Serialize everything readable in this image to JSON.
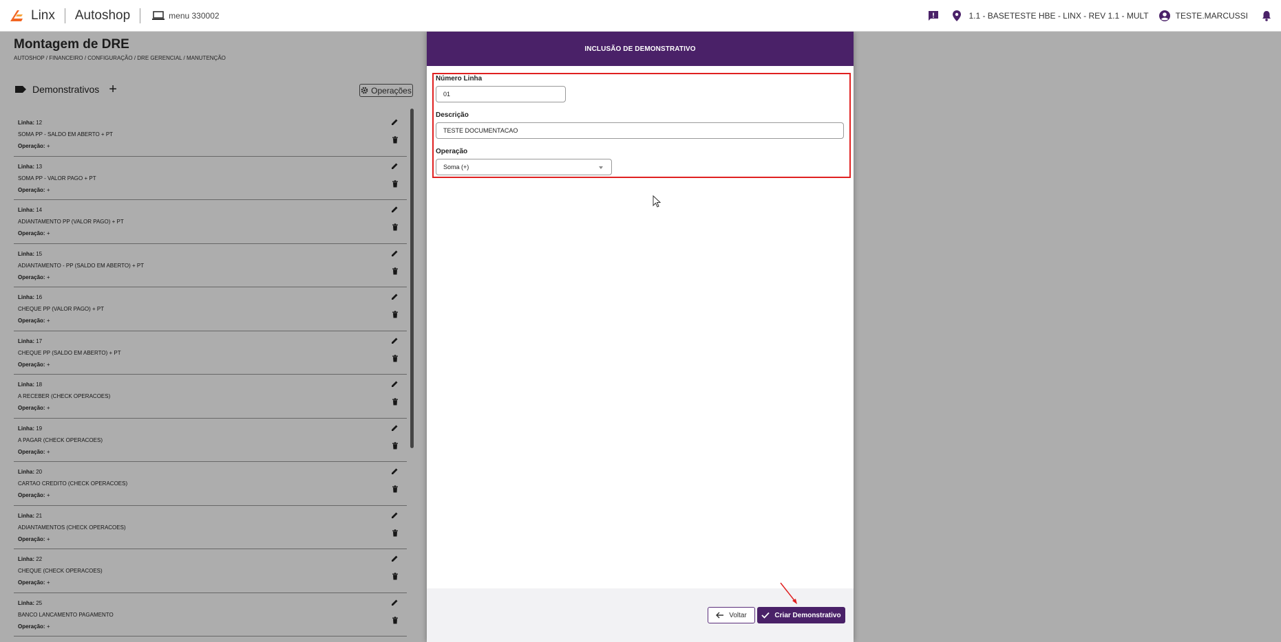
{
  "topbar": {
    "brand": "Linx",
    "app": "Autoshop",
    "menu": "menu 330002",
    "location": "1.1 - BASETESTE HBE - LINX - REV 1.1 - MULT",
    "user": "TESTE.MARCUSSI"
  },
  "page": {
    "title": "Montagem de DRE",
    "breadcrumb": "AUTOSHOP / FINANCEIRO / CONFIGURAÇÃO / DRE GERENCIAL / MANUTENÇÃO",
    "section_label": "Demonstrativos",
    "add_symbol": "+",
    "operations_label": "Operações",
    "line_label": "Linha:",
    "op_label": "Operação:",
    "rows": [
      {
        "linha": "12",
        "desc": "SOMA PP - SALDO EM ABERTO + PT",
        "op": "+"
      },
      {
        "linha": "13",
        "desc": "SOMA PP - VALOR PAGO + PT",
        "op": "+"
      },
      {
        "linha": "14",
        "desc": "ADIANTAMENTO PP (VALOR PAGO) + PT",
        "op": "+"
      },
      {
        "linha": "15",
        "desc": "ADIANTAMENTO - PP (SALDO EM ABERTO) + PT",
        "op": "+"
      },
      {
        "linha": "16",
        "desc": "CHEQUE PP (VALOR PAGO) + PT",
        "op": "+"
      },
      {
        "linha": "17",
        "desc": "CHEQUE PP (SALDO EM ABERTO) + PT",
        "op": "+"
      },
      {
        "linha": "18",
        "desc": "A RECEBER (CHECK OPERACOES)",
        "op": "+"
      },
      {
        "linha": "19",
        "desc": "A PAGAR (CHECK OPERACOES)",
        "op": "+"
      },
      {
        "linha": "20",
        "desc": "CARTAO CREDITO (CHECK OPERACOES)",
        "op": "+"
      },
      {
        "linha": "21",
        "desc": "ADIANTAMENTOS (CHECK OPERACOES)",
        "op": "+"
      },
      {
        "linha": "22",
        "desc": "CHEQUE (CHECK OPERACOES)",
        "op": "+"
      },
      {
        "linha": "25",
        "desc": "BANCO LANCAMENTO PAGAMENTO",
        "op": "+"
      }
    ]
  },
  "modal": {
    "title": "INCLUSÃO DE DEMONSTRATIVO",
    "numero_label": "Número Linha",
    "numero_value": "01",
    "descricao_label": "Descrição",
    "descricao_value": "TESTE DOCUMENTACAO",
    "operacao_label": "Operação",
    "operacao_value": "Soma (+)",
    "back_label": "Voltar",
    "create_label": "Criar Demonstrativo"
  },
  "colors": {
    "brand_purple": "#4a2168",
    "highlight_red": "#e02020",
    "logo_orange": "#f26522"
  },
  "icons": [
    "linx-logo-icon",
    "laptop-icon",
    "feedback-icon",
    "location-pin-icon",
    "account-circle-icon",
    "bell-icon",
    "tag-icon",
    "plus-icon",
    "gear-icon",
    "pencil-icon",
    "trash-icon",
    "arrow-left-icon",
    "check-icon"
  ]
}
